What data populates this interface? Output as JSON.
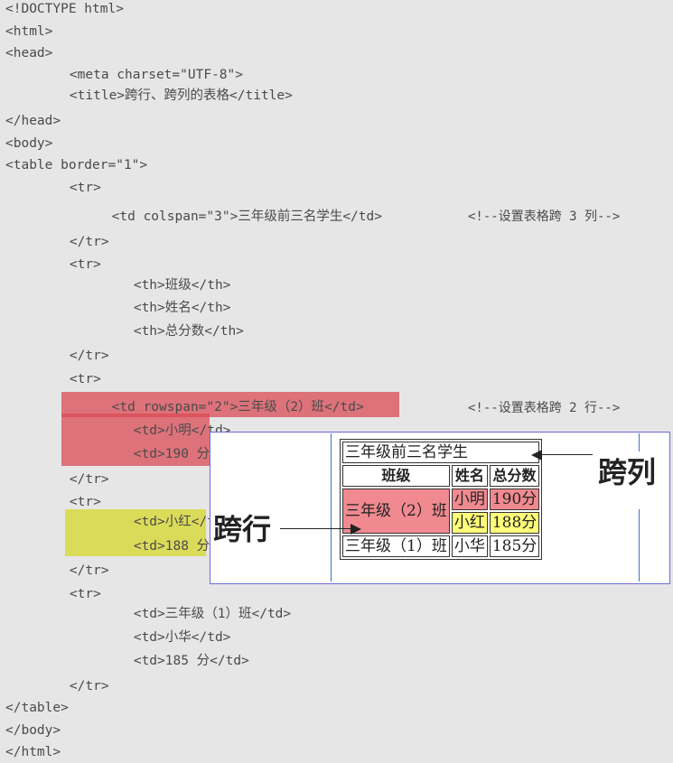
{
  "code_lines": [
    "<!DOCTYPE html>",
    "<html>",
    "<head>",
    "    <meta charset=\"UTF-8\">",
    "    <title>跨行、跨列的表格</title>",
    "</head>",
    "<body>",
    "<table border=\"1\">",
    "    <tr>",
    "     <td colspan=\"3\">三年级前三名学生</td>",
    "    </tr>",
    "    <tr>",
    "        <th>班级</th>",
    "        <th>姓名</th>",
    "        <th>总分数</th>",
    "    </tr>",
    "    <tr>",
    "     <td rowspan=\"2\">三年级（2）班</td>",
    "        <td>小明</td>",
    "        <td>190 分</td>",
    "    </tr>",
    "    <tr>",
    "        <td>小红</td>",
    "        <td>188 分</td>",
    "    </tr>",
    "    <tr>",
    "        <td>三年级（1）班</td>",
    "        <td>小华</td>",
    "        <td>185 分</td>",
    "    </tr>",
    "</table>",
    "</body>",
    "</html>"
  ],
  "comments": {
    "colspan": "<!--设置表格跨 3 列-->",
    "rowspan": "<!--设置表格跨 2 行-->"
  },
  "preview": {
    "caption": "三年级前三名学生",
    "headers": [
      "班级",
      "姓名",
      "总分数"
    ],
    "row1": {
      "class": "三年级（2）班",
      "name": "小明",
      "score": "190分"
    },
    "row2": {
      "name": "小红",
      "score": "188分"
    },
    "row3": {
      "class": "三年级（1）班",
      "name": "小华",
      "score": "185分"
    }
  },
  "labels": {
    "colspan": "跨列",
    "rowspan": "跨行"
  },
  "colors": {
    "red_highlight": "#d94b55",
    "yellow_highlight": "#d9d94a",
    "red_cell": "#f08a90",
    "yellow_cell": "#ffff7a"
  }
}
